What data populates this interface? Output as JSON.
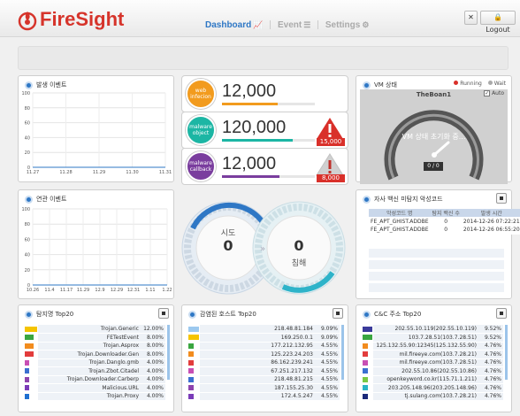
{
  "header": {
    "app_name": "FireSight",
    "nav": [
      {
        "label": "Dashboard",
        "icon": "chart-icon",
        "active": true
      },
      {
        "label": "Event",
        "icon": "list-icon",
        "active": false
      },
      {
        "label": "Settings",
        "icon": "gear-icon",
        "active": false
      }
    ],
    "logout_label": "Logout"
  },
  "panels": {
    "events": {
      "title": "발생 이벤트"
    },
    "related": {
      "title": "연관 이벤트"
    },
    "vm": {
      "title": "VM 상태",
      "legend_running": "Running",
      "legend_wait": "Wait",
      "machine_name": "TheBoan1",
      "auto_label": "Auto",
      "status_text": "VM 상태 초기화 중...",
      "counter": "0 / 0"
    },
    "vaccine": {
      "title": "자사 백신 미탐지 악성코드",
      "headers": [
        "악성코드 명",
        "탐지 백신 수",
        "발생 시간"
      ],
      "rows": [
        {
          "name": "FE_APT_GHIST.ADDBE",
          "count": "0",
          "time": "2014-12-26 07:22:21"
        },
        {
          "name": "FE_APT_GHIST.ADDBE",
          "count": "0",
          "time": "2014-12-26 06:55:20"
        }
      ]
    },
    "gauge": {
      "attempt_label": "시도",
      "attempt_value": "0",
      "breach_value": "0",
      "breach_label": "침해"
    },
    "detect_top": {
      "title": "탐지명 Top20",
      "rows": [
        {
          "name": "Trojan.Generic",
          "pct": "12.00%",
          "color": "#f5c400",
          "share": 12.0
        },
        {
          "name": "FETestEvent",
          "pct": "8.00%",
          "color": "#3aa640",
          "share": 8.0
        },
        {
          "name": "Trojan.Asprox",
          "pct": "8.00%",
          "color": "#f28c1e",
          "share": 8.0
        },
        {
          "name": "Trojan.Downloader.Gen",
          "pct": "8.00%",
          "color": "#e23c3c",
          "share": 8.0
        },
        {
          "name": "Trojan.Danglo.gmb",
          "pct": "4.00%",
          "color": "#c84fb4",
          "share": 4.0
        },
        {
          "name": "Trojan.Zbot.Citadel",
          "pct": "4.00%",
          "color": "#3b6fd0",
          "share": 4.0
        },
        {
          "name": "Trojan.Downloader.Carberp",
          "pct": "4.00%",
          "color": "#8e44ad",
          "share": 4.0
        },
        {
          "name": "Malicious.URL",
          "pct": "4.00%",
          "color": "#7a3bb8",
          "share": 4.0
        },
        {
          "name": "Trojan.Proxy",
          "pct": "4.00%",
          "color": "#1f6fd0",
          "share": 4.0
        }
      ]
    },
    "infected_hosts": {
      "title": "감염된 호스트 Top20",
      "rows": [
        {
          "name": "218.48.81.184",
          "pct": "9.09%",
          "color": "#9cc9ef",
          "share": 9.09
        },
        {
          "name": "169.250.0.1",
          "pct": "9.09%",
          "color": "#f5c400",
          "share": 9.09
        },
        {
          "name": "177.212.132.95",
          "pct": "4.55%",
          "color": "#3aa640",
          "share": 4.55
        },
        {
          "name": "125.223.24.203",
          "pct": "4.55%",
          "color": "#f28c1e",
          "share": 4.55
        },
        {
          "name": "86.162.239.241",
          "pct": "4.55%",
          "color": "#e23c3c",
          "share": 4.55
        },
        {
          "name": "67.251.217.132",
          "pct": "4.55%",
          "color": "#c84fb4",
          "share": 4.55
        },
        {
          "name": "218.48.81.215",
          "pct": "4.55%",
          "color": "#3b6fd0",
          "share": 4.55
        },
        {
          "name": "187.155.25.30",
          "pct": "4.55%",
          "color": "#8e44ad",
          "share": 4.55
        },
        {
          "name": "172.4.5.247",
          "pct": "4.55%",
          "color": "#7a3bb8",
          "share": 4.55
        }
      ]
    },
    "cnc_top": {
      "title": "C&C 주소 Top20",
      "rows": [
        {
          "name": "202.55.10.119(202.55.10.119)",
          "pct": "9.52%",
          "color": "#3b3b9b",
          "share": 9.52
        },
        {
          "name": "103.7.28.51(103.7.28.51)",
          "pct": "9.52%",
          "color": "#3aa640",
          "share": 9.52
        },
        {
          "name": "125.132.55.90:12345(125.132.55.90)",
          "pct": "4.76%",
          "color": "#f28c1e",
          "share": 4.76
        },
        {
          "name": "mil.fireeye.com(103.7.28.21)",
          "pct": "4.76%",
          "color": "#e23c3c",
          "share": 4.76
        },
        {
          "name": "mil.fireeye.com(103.7.28.51)",
          "pct": "4.76%",
          "color": "#c84fb4",
          "share": 4.76
        },
        {
          "name": "202.55.10.86(202.55.10.86)",
          "pct": "4.76%",
          "color": "#3b6fd0",
          "share": 4.76
        },
        {
          "name": "openkeyword.co.kr(115.71.1.211)",
          "pct": "4.76%",
          "color": "#7ac943",
          "share": 4.76
        },
        {
          "name": "203.205.148.96(203.205.148.96)",
          "pct": "4.76%",
          "color": "#2ab5c5",
          "share": 4.76
        },
        {
          "name": "tj.sulang.com(103.7.28.21)",
          "pct": "4.76%",
          "color": "#1b2a7a",
          "share": 4.76
        }
      ]
    }
  },
  "stats": [
    {
      "label_line1": "web",
      "label_line2": "infecion",
      "value": "12,000",
      "color": "#f29b1e",
      "progress": 0.6,
      "alert": ""
    },
    {
      "label_line1": "malware",
      "label_line2": "object",
      "value": "120,000",
      "color": "#1cb6a4",
      "progress": 0.76,
      "alert": "15,000"
    },
    {
      "label_line1": "malware",
      "label_line2": "callback",
      "value": "12,000",
      "color": "#7a3d9e",
      "progress": 0.62,
      "alert": "8,000"
    }
  ],
  "chart_data": [
    {
      "type": "line",
      "title": "발생 이벤트",
      "x": [
        "11.27",
        "11.28",
        "11.29",
        "11.30",
        "11.31"
      ],
      "series": [
        {
          "values": [
            0,
            0,
            0,
            0,
            0
          ]
        }
      ],
      "ylim": [
        0,
        100
      ],
      "yticks": [
        0,
        20,
        40,
        60,
        80,
        100
      ],
      "grid": true
    },
    {
      "type": "line",
      "title": "연관 이벤트",
      "x": [
        "10.26",
        "11.4",
        "11.17",
        "11.29",
        "12.9",
        "12.29",
        "12.31",
        "1.11",
        "1.22"
      ],
      "series": [
        {
          "values": [
            0,
            0,
            0,
            0,
            0,
            0,
            0,
            0,
            0
          ]
        }
      ],
      "ylim": [
        0,
        100
      ],
      "yticks": [
        0,
        20,
        40,
        60,
        80,
        100
      ],
      "grid": true
    }
  ]
}
